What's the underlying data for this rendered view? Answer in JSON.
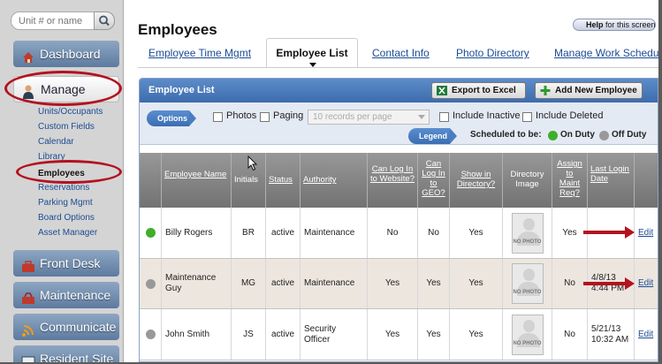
{
  "search": {
    "placeholder": "Unit # or name"
  },
  "nav": {
    "dashboard": "Dashboard",
    "manage": "Manage",
    "manage_sub": [
      "Units/Occupants",
      "Custom Fields",
      "Calendar",
      "Library",
      "Employees",
      "Reservations",
      "Parking Mgmt",
      "Board Options",
      "Asset Manager"
    ],
    "front_desk": "Front Desk",
    "maintenance": "Maintenance",
    "communicate": "Communicate",
    "resident_site": "Resident Site"
  },
  "page": {
    "title": "Employees",
    "help_prefix": "Help",
    "help_suffix": "for this screen"
  },
  "tabs": [
    "Employee Time Mgmt",
    "Employee List",
    "Contact Info",
    "Photo Directory",
    "Manage Work Schedule"
  ],
  "panel": {
    "title": "Employee List",
    "export_label": "Export to Excel",
    "add_label": "Add New Employee"
  },
  "options": {
    "label": "Options",
    "photos": "Photos",
    "paging": "Paging",
    "records_placeholder": "10 records per page",
    "include_inactive": "Include Inactive",
    "include_deleted": "Include Deleted"
  },
  "legend": {
    "label": "Legend",
    "scheduled": "Scheduled to be:",
    "on_duty": "On Duty",
    "off_duty": "Off Duty"
  },
  "colors": {
    "on_duty": "#3fae2a",
    "off_duty": "#999999",
    "header_blue": "#4a7cc2",
    "annotation_red": "#b3121f"
  },
  "table": {
    "headers": [
      "Employee Name",
      "Initials",
      "Status",
      "Authority",
      "Can Log In to Website?",
      "Can Log In to GEO?",
      "Show in Directory?",
      "Directory Image",
      "Assign to Maint Req?",
      "Last Login Date"
    ],
    "no_photo": "NO PHOTO",
    "rows": [
      {
        "duty": "on",
        "name": "Billy Rogers",
        "initials": "BR",
        "status": "active",
        "authority": "Maintenance",
        "website": "No",
        "geo": "No",
        "directory": "Yes",
        "maint": "Yes",
        "last_login": "",
        "action": "Edit"
      },
      {
        "duty": "off",
        "name": "Maintenance Guy",
        "initials": "MG",
        "status": "active",
        "authority": "Maintenance",
        "website": "Yes",
        "geo": "Yes",
        "directory": "Yes",
        "maint": "No",
        "last_login": "4/8/13 4:44 PM",
        "action": "Edit"
      },
      {
        "duty": "off",
        "name": "John Smith",
        "initials": "JS",
        "status": "active",
        "authority": "Security Officer",
        "website": "Yes",
        "geo": "Yes",
        "directory": "Yes",
        "maint": "No",
        "last_login": "5/21/13 10:32 AM",
        "action": "Edit"
      }
    ]
  }
}
